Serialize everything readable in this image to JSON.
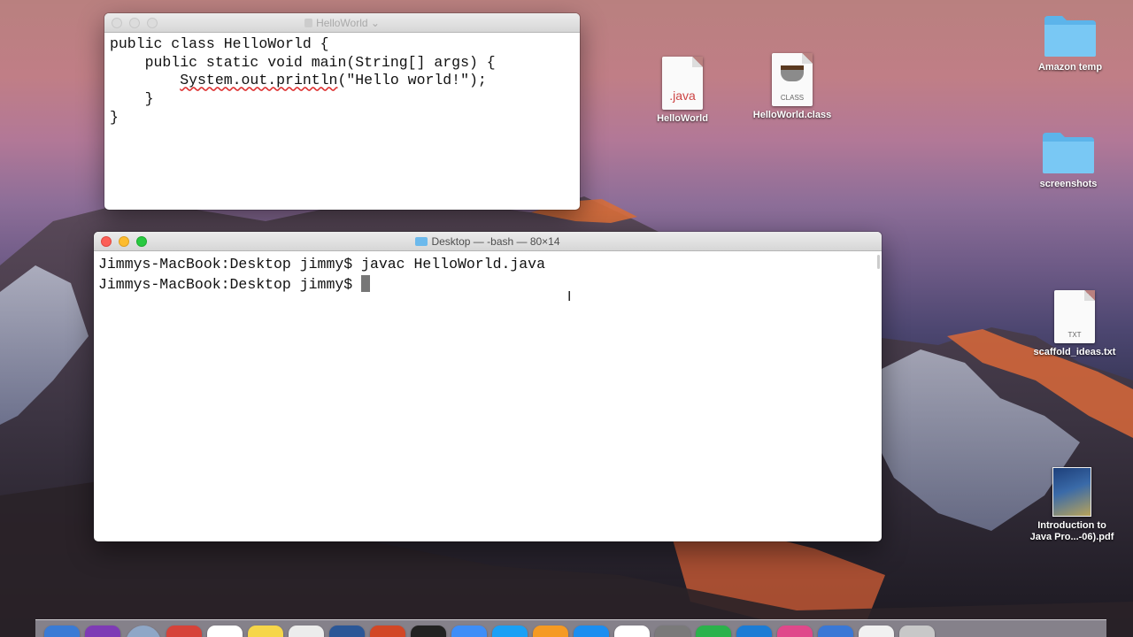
{
  "editor": {
    "title": "HelloWorld",
    "code": {
      "line1": "public class HelloWorld {",
      "line2": "    public static void main(String[] args) {",
      "line3_indent": "        ",
      "line3_call": "System.out.println",
      "line3_rest": "(\"Hello world!\");",
      "line4": "    }",
      "line5": "}"
    }
  },
  "terminal": {
    "title": "Desktop — -bash — 80×14",
    "line1": "Jimmys-MacBook:Desktop jimmy$ javac HelloWorld.java",
    "prompt": "Jimmys-MacBook:Desktop jimmy$ "
  },
  "desktop_icons": {
    "amazon_temp": "Amazon temp",
    "screenshots": "screenshots",
    "helloworld_java": "HelloWorld",
    "helloworld_java_tag": ".java",
    "helloworld_class": "HelloWorld.class",
    "helloworld_class_tag": "CLASS",
    "scaffold_ideas": "scaffold_ideas.txt",
    "scaffold_ideas_tag": "TXT",
    "intro_java_pdf_line1": "Introduction to",
    "intro_java_pdf_line2": "Java Pro...-06).pdf"
  },
  "dock": {
    "apps": [
      "siri",
      "safari",
      "chrome",
      "calendar",
      "notes",
      "reminders",
      "word",
      "powerpoint",
      "terminal",
      "finder",
      "messages",
      "pages",
      "app-store",
      "photos",
      "system-preferences",
      "numbers",
      "xcode",
      "itunes",
      "mail",
      "textedit",
      "preview",
      "trash"
    ],
    "colors": [
      "#3a7bd5",
      "#7e3bb5",
      "#8fa7c7",
      "#d6433a",
      "#ffffff",
      "#f6d64a",
      "#ececec",
      "#2b5797",
      "#d24726",
      "#222222",
      "#3e8ef7",
      "#1aa0f5",
      "#f59a23",
      "#1b8ef0",
      "#ffffff",
      "#7a7a7a",
      "#2bb24c",
      "#1c7cd5",
      "#e0488b",
      "#3a78d6",
      "#f1f1f1",
      "#c8c8c8"
    ]
  }
}
